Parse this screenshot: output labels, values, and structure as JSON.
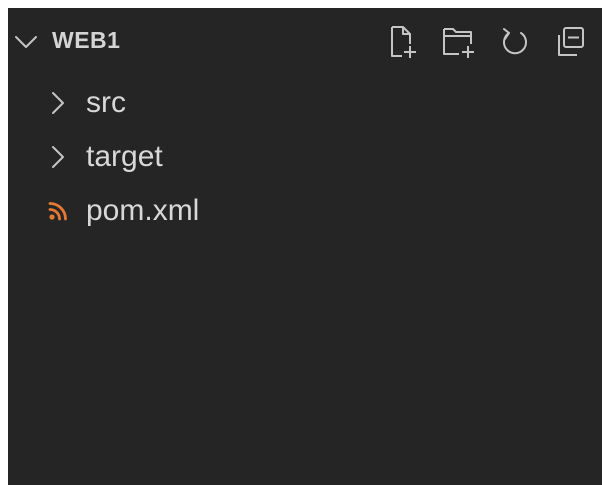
{
  "explorer": {
    "workspace_title": "WEB1",
    "actions": [
      {
        "name": "new-file-icon"
      },
      {
        "name": "new-folder-icon"
      },
      {
        "name": "refresh-icon"
      },
      {
        "name": "collapse-all-icon"
      }
    ],
    "items": [
      {
        "label": "src",
        "kind": "folder",
        "expanded": false
      },
      {
        "label": "target",
        "kind": "folder",
        "expanded": false
      },
      {
        "label": "pom.xml",
        "kind": "file",
        "icon": "rss-icon"
      }
    ]
  },
  "colors": {
    "background": "#252526",
    "text": "#d8d8d8",
    "icon": "#c5c5c5",
    "xml_icon": "#e37933"
  }
}
